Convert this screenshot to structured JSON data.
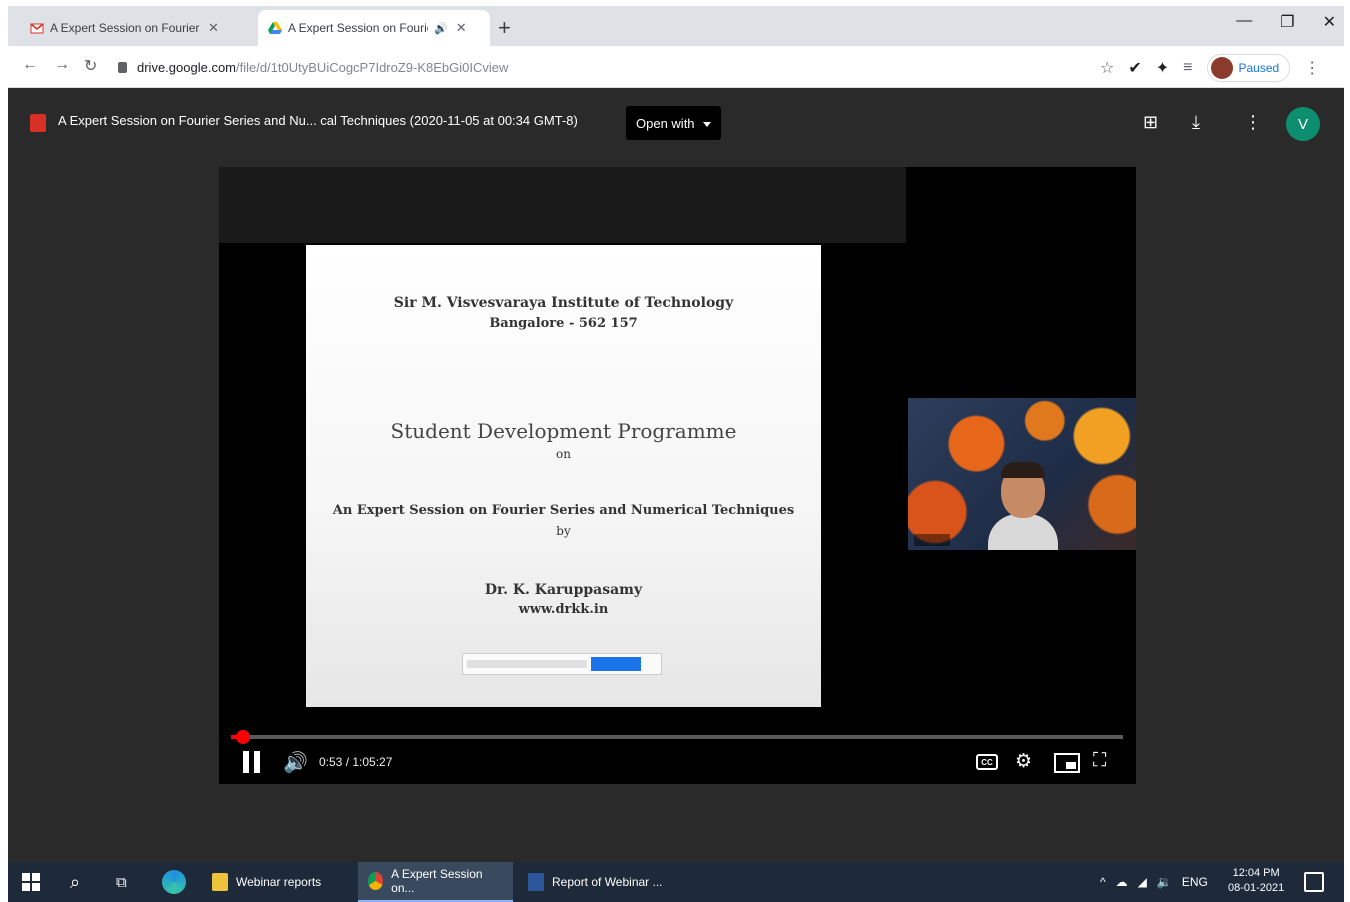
{
  "browser": {
    "tabs": [
      {
        "title": "A Expert Session on Fourier Seri",
        "favicon": "gmail-icon"
      },
      {
        "title": "A Expert Session on Fourie",
        "favicon": "drive-icon",
        "active": true
      }
    ],
    "url_domain": "drive.google.com",
    "url_path": "/file/d/1t0UtyBUiCogcP7IdroZ9-K8EbGi0ICview",
    "profile_label": "Paused"
  },
  "viewer": {
    "file_title": "A Expert Session on Fourier Series and Nu... cal Techniques (2020-11-05 at 00:34 GMT-8)",
    "open_with_label": "Open with",
    "user_initial": "V"
  },
  "slide": {
    "institute": "Sir M. Visvesvaraya Institute of Technology",
    "city": "Bangalore - 562 157",
    "programme": "Student Development Programme",
    "on": "on",
    "topic": "An Expert Session on Fourier Series and Numerical Techniques",
    "by": "by",
    "speaker": "Dr. K. Karuppasamy",
    "website": "www.drkk.in"
  },
  "player": {
    "time": "0:53 / 1:05:27",
    "progress_fraction": 0.013
  },
  "taskbar": {
    "apps": [
      {
        "label": "Webinar reports"
      },
      {
        "label": "A Expert Session on..."
      },
      {
        "label": "Report of Webinar ..."
      }
    ],
    "tray_lang": "ENG",
    "time": "12:04 PM",
    "date": "08-01-2021"
  }
}
